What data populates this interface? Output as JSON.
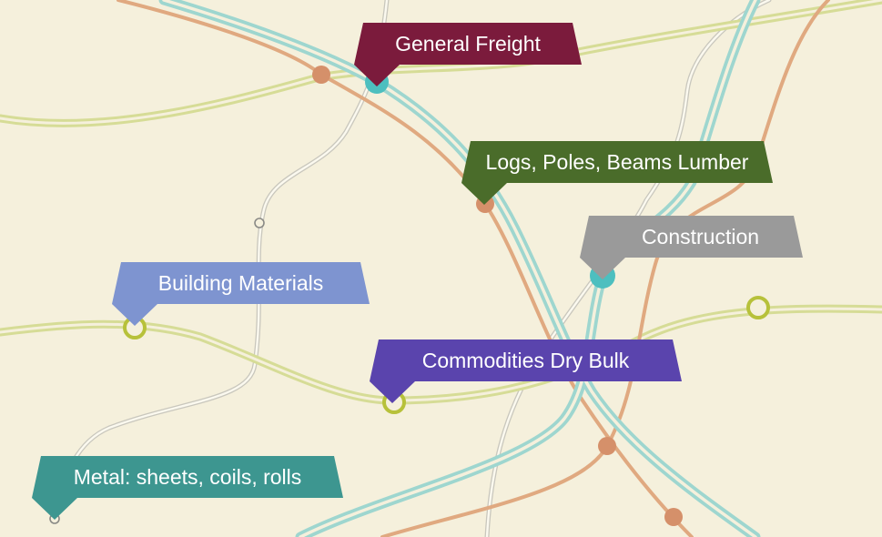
{
  "colors": {
    "background": "#f5f0dc",
    "route_teal": "#9ed6cf",
    "route_orange": "#e0a980",
    "route_lime": "#d6dc96",
    "route_gray": "#c9c7bd"
  },
  "tags": [
    {
      "label": "General Freight",
      "color": "#7b1b3c"
    },
    {
      "label": "Logs, Poles, Beams Lumber",
      "color": "#4a6c2a"
    },
    {
      "label": "Construction",
      "color": "#9a9a9a"
    },
    {
      "label": "Building Materials",
      "color": "#7e94d0"
    },
    {
      "label": "Commodities Dry Bulk",
      "color": "#5a44ad"
    },
    {
      "label": "Metal: sheets, coils, rolls",
      "color": "#3d9690"
    }
  ]
}
